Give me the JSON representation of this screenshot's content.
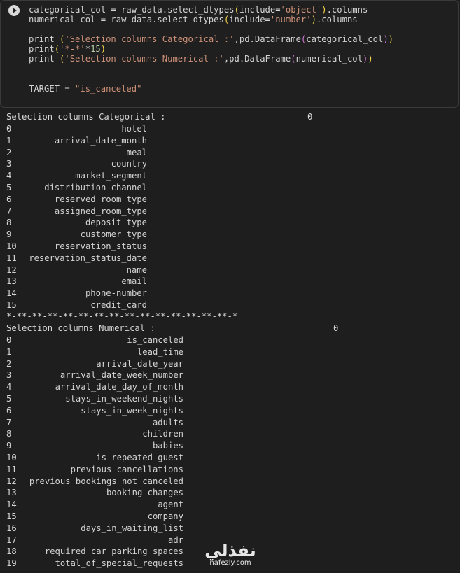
{
  "code": {
    "line1": {
      "a": "categorical_col = raw_data.select_dtypes",
      "b": "include=",
      "c": "'object'",
      "d": ".columns"
    },
    "line2": {
      "a": "numerical_col = raw_data.select_dtypes",
      "b": "include=",
      "c": "'number'",
      "d": ".columns"
    },
    "line3": {
      "a": "print ",
      "b": "'Selection columns Categorical :'",
      "c": ",pd.DataFrame",
      "d": "categorical_col"
    },
    "line4": {
      "a": "print",
      "b": "'*-*'",
      "c": "*",
      "d": "15"
    },
    "line5": {
      "a": "print ",
      "b": "'Selection columns Numerical :'",
      "c": ",pd.DataFrame",
      "d": "numerical_col"
    },
    "line6": {
      "a": "TARGET = ",
      "b": "\"is_canceled\""
    }
  },
  "output": {
    "categorical_header": "Selection columns Categorical :",
    "categorical_col_label": "0",
    "categorical": [
      "hotel",
      "arrival_date_month",
      "meal",
      "country",
      "market_segment",
      "distribution_channel",
      "reserved_room_type",
      "assigned_room_type",
      "deposit_type",
      "customer_type",
      "reservation_status",
      "reservation_status_date",
      "name",
      "email",
      "phone-number",
      "credit_card"
    ],
    "separator": "*-**-**-**-**-**-**-**-**-**-**-**-**-**-**-*",
    "numerical_header": "Selection columns Numerical :",
    "numerical_col_label": "0",
    "numerical": [
      "is_canceled",
      "lead_time",
      "arrival_date_year",
      "arrival_date_week_number",
      "arrival_date_day_of_month",
      "stays_in_weekend_nights",
      "stays_in_week_nights",
      "adults",
      "children",
      "babies",
      "is_repeated_guest",
      "previous_cancellations",
      "previous_bookings_not_canceled",
      "booking_changes",
      "agent",
      "company",
      "days_in_waiting_list",
      "adr",
      "required_car_parking_spaces",
      "total_of_special_requests"
    ]
  },
  "watermark": {
    "arabic": "نفذلي",
    "latin": "nafezly.com"
  }
}
